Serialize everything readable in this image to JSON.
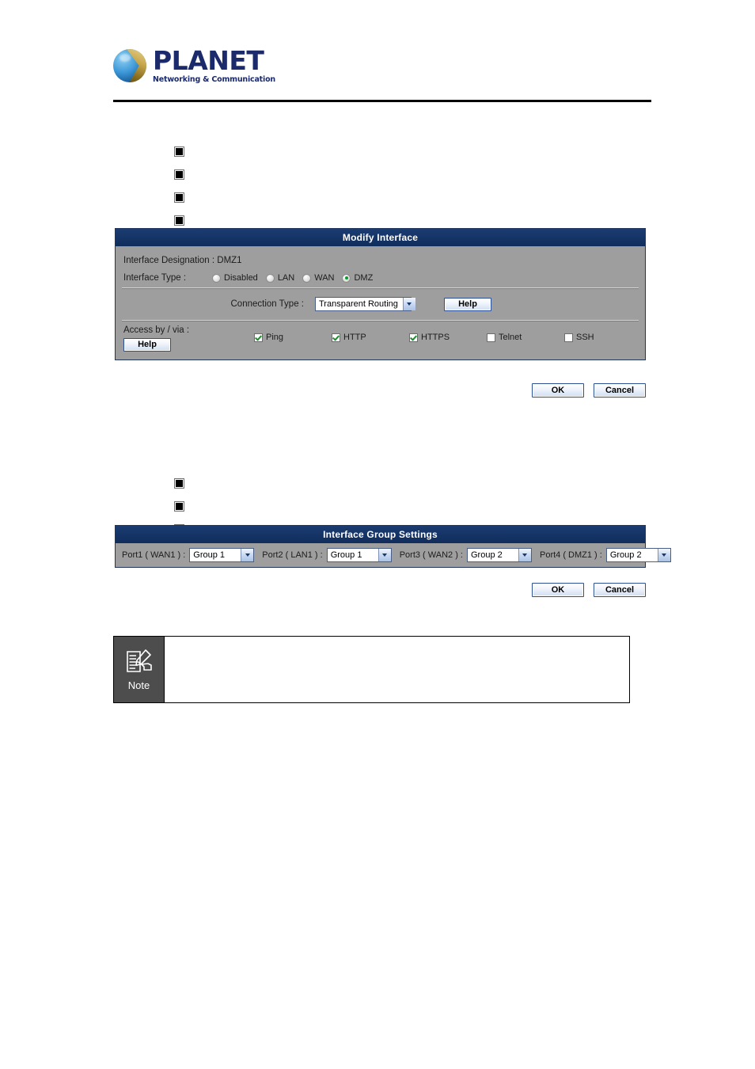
{
  "header": {
    "brand_name": "PLANET",
    "brand_tagline": "Networking & Communication",
    "logo_icon": "planet-globe-logo"
  },
  "bullets_top": [
    {
      "marker": "square-bullet",
      "text": ""
    },
    {
      "marker": "square-bullet",
      "text": ""
    },
    {
      "marker": "square-bullet",
      "text": ""
    },
    {
      "marker": "square-bullet",
      "text": ""
    },
    {
      "marker": "square-bullet",
      "text": ""
    }
  ],
  "bullets_mid": [
    {
      "marker": "square-bullet",
      "text": ""
    },
    {
      "marker": "square-bullet",
      "text": ""
    },
    {
      "marker": "square-bullet",
      "text": ""
    }
  ],
  "modify_interface": {
    "title": "Modify Interface",
    "designation_label": "Interface Designation : DMZ1",
    "interface_type_label": "Interface Type :",
    "interface_type_options": [
      {
        "label": "Disabled",
        "selected": false
      },
      {
        "label": "LAN",
        "selected": false
      },
      {
        "label": "WAN",
        "selected": false
      },
      {
        "label": "DMZ",
        "selected": true
      }
    ],
    "connection_type_label": "Connection Type :",
    "connection_type_value": "Transparent Routing",
    "connection_help_label": "Help",
    "access_label": "Access by / via :",
    "access_help_label": "Help",
    "access_options": [
      {
        "label": "Ping",
        "checked": true
      },
      {
        "label": "HTTP",
        "checked": true
      },
      {
        "label": "HTTPS",
        "checked": true
      },
      {
        "label": "Telnet",
        "checked": false
      },
      {
        "label": "SSH",
        "checked": false
      }
    ],
    "ok_label": "OK",
    "cancel_label": "Cancel"
  },
  "group_settings": {
    "title": "Interface Group Settings",
    "ports": [
      {
        "label": "Port1 ( WAN1 ) :",
        "value": "Group 1"
      },
      {
        "label": "Port2 ( LAN1 ) :",
        "value": "Group 1"
      },
      {
        "label": "Port3 ( WAN2 ) :",
        "value": "Group 2"
      },
      {
        "label": "Port4 ( DMZ1 ) :",
        "value": "Group 2"
      }
    ],
    "ok_label": "OK",
    "cancel_label": "Cancel"
  },
  "note": {
    "badge_label": "Note",
    "icon": "note-pencil-hand-icon",
    "body_text": ""
  },
  "colors": {
    "title_bar": "#16376b",
    "panel_body": "#9e9e9e",
    "note_badge": "#4d4d4d",
    "brand": "#1b2a6b",
    "check_green": "#1a8f2e"
  }
}
